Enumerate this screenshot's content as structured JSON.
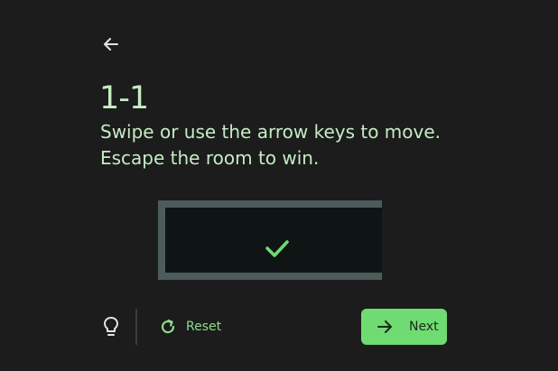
{
  "level": {
    "title": "1-1",
    "instructions": [
      "Swipe or use the arrow keys to move.",
      "Escape the room to win."
    ]
  },
  "board": {
    "status": "solved",
    "status_icon": "check-icon",
    "colors": {
      "wall": "#4b5c5a",
      "floor": "#0f1514",
      "check": "#6fdc73"
    }
  },
  "toolbar": {
    "back_icon": "arrow-left-icon",
    "hint_icon": "lightbulb-icon",
    "reset_icon": "refresh-icon",
    "reset_label": "Reset",
    "next_icon": "arrow-right-icon",
    "next_label": "Next"
  },
  "colors": {
    "background": "#1b1c1b",
    "text": "#c6ecc4",
    "accent": "#6fdc73"
  }
}
